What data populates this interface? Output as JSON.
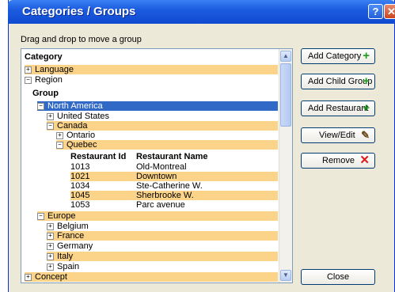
{
  "window": {
    "title": "Categories / Groups",
    "help_label": "?",
    "close_label": "✕"
  },
  "instructions": "Drag and drop to move a group",
  "tree": {
    "category_header": "Category",
    "language": "Language",
    "region": "Region",
    "group_header": "Group",
    "north_america": "North America",
    "united_states": "United States",
    "canada": "Canada",
    "ontario": "Ontario",
    "quebec": "Quebec",
    "restaurant_id_header": "Restaurant Id",
    "restaurant_name_header": "Restaurant Name",
    "restaurants": [
      {
        "id": "1013",
        "name": "Old-Montreal"
      },
      {
        "id": "1021",
        "name": "Downtown"
      },
      {
        "id": "1034",
        "name": "Ste-Catherine W."
      },
      {
        "id": "1045",
        "name": "Sherbrooke W."
      },
      {
        "id": "1053",
        "name": "Parc avenue"
      }
    ],
    "europe": "Europe",
    "belgium": "Belgium",
    "france": "France",
    "germany": "Germany",
    "italy": "Italy",
    "spain": "Spain",
    "concept": "Concept"
  },
  "buttons": {
    "add_category": "Add Category",
    "add_child_group": "Add Child Group",
    "add_restaurant": "Add Restaurant",
    "view_edit": "View/Edit",
    "remove": "Remove",
    "close": "Close"
  },
  "icons": {
    "plus": "+",
    "minus": "−",
    "pencil": "✎",
    "cross": "✕",
    "up": "▲",
    "down": "▼"
  },
  "colors": {
    "highlight_row": "#fbd48a",
    "selected_row": "#3169c6",
    "title_bar": "#1c5be0"
  }
}
